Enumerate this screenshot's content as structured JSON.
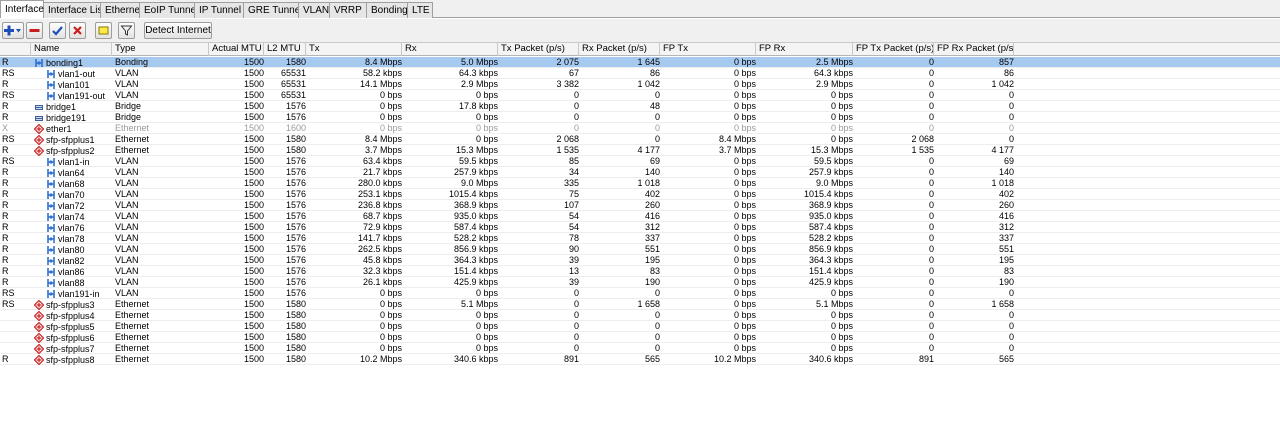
{
  "tabs": [
    "Interface",
    "Interface List",
    "Ethernet",
    "EoIP Tunnel",
    "IP Tunnel",
    "GRE Tunnel",
    "VLAN",
    "VRRP",
    "Bonding",
    "LTE"
  ],
  "active_tab": 0,
  "toolbar": {
    "detect_internet_label": "Detect Internet"
  },
  "columns": [
    "Name",
    "Type",
    "Actual MTU",
    "L2 MTU",
    "Tx",
    "Rx",
    "Tx Packet (p/s)",
    "Rx Packet (p/s)",
    "FP Tx",
    "FP Rx",
    "FP Tx Packet (p/s)",
    "FP Rx Packet (p/s)"
  ],
  "colors": {
    "selected_row": "#a6c9f0",
    "vlan_icon": "#2f6fd0",
    "ethernet_icon": "#c81e1e",
    "bridge_icon": "#3e5f9c"
  },
  "rows": [
    {
      "flags": "R",
      "name": "bonding1",
      "indent": 0,
      "icon": "bonding-icon",
      "type": "Bonding",
      "actual_mtu": "1500",
      "l2_mtu": "1580",
      "tx": "8.4 Mbps",
      "rx": "5.0 Mbps",
      "tx_pps": "2 075",
      "rx_pps": "1 645",
      "fp_tx": "0 bps",
      "fp_rx": "2.5 Mbps",
      "fp_tx_pps": "0",
      "fp_rx_pps": "857",
      "selected": true
    },
    {
      "flags": "RS",
      "name": "vlan1-out",
      "indent": 1,
      "icon": "vlan-icon",
      "type": "VLAN",
      "actual_mtu": "1500",
      "l2_mtu": "65531",
      "tx": "58.2 kbps",
      "rx": "64.3 kbps",
      "tx_pps": "67",
      "rx_pps": "86",
      "fp_tx": "0 bps",
      "fp_rx": "64.3 kbps",
      "fp_tx_pps": "0",
      "fp_rx_pps": "86"
    },
    {
      "flags": "R",
      "name": "vlan101",
      "indent": 1,
      "icon": "vlan-icon",
      "type": "VLAN",
      "actual_mtu": "1500",
      "l2_mtu": "65531",
      "tx": "14.1 Mbps",
      "rx": "2.9 Mbps",
      "tx_pps": "3 382",
      "rx_pps": "1 042",
      "fp_tx": "0 bps",
      "fp_rx": "2.9 Mbps",
      "fp_tx_pps": "0",
      "fp_rx_pps": "1 042"
    },
    {
      "flags": "RS",
      "name": "vlan191-out",
      "indent": 1,
      "icon": "vlan-icon",
      "type": "VLAN",
      "actual_mtu": "1500",
      "l2_mtu": "65531",
      "tx": "0 bps",
      "rx": "0 bps",
      "tx_pps": "0",
      "rx_pps": "0",
      "fp_tx": "0 bps",
      "fp_rx": "0 bps",
      "fp_tx_pps": "0",
      "fp_rx_pps": "0"
    },
    {
      "flags": "R",
      "name": "bridge1",
      "indent": 0,
      "icon": "bridge-icon",
      "type": "Bridge",
      "actual_mtu": "1500",
      "l2_mtu": "1576",
      "tx": "0 bps",
      "rx": "17.8 kbps",
      "tx_pps": "0",
      "rx_pps": "48",
      "fp_tx": "0 bps",
      "fp_rx": "0 bps",
      "fp_tx_pps": "0",
      "fp_rx_pps": "0"
    },
    {
      "flags": "R",
      "name": "bridge191",
      "indent": 0,
      "icon": "bridge-icon",
      "type": "Bridge",
      "actual_mtu": "1500",
      "l2_mtu": "1576",
      "tx": "0 bps",
      "rx": "0 bps",
      "tx_pps": "0",
      "rx_pps": "0",
      "fp_tx": "0 bps",
      "fp_rx": "0 bps",
      "fp_tx_pps": "0",
      "fp_rx_pps": "0"
    },
    {
      "flags": "X",
      "name": "ether1",
      "indent": 0,
      "icon": "ethernet-icon",
      "type": "Ethernet",
      "actual_mtu": "1500",
      "l2_mtu": "1600",
      "tx": "0 bps",
      "rx": "0 bps",
      "tx_pps": "0",
      "rx_pps": "0",
      "fp_tx": "0 bps",
      "fp_rx": "0 bps",
      "fp_tx_pps": "0",
      "fp_rx_pps": "0",
      "disabled": true
    },
    {
      "flags": "RS",
      "name": "sfp-sfpplus1",
      "indent": 0,
      "icon": "ethernet-icon",
      "type": "Ethernet",
      "actual_mtu": "1500",
      "l2_mtu": "1580",
      "tx": "8.4 Mbps",
      "rx": "0 bps",
      "tx_pps": "2 068",
      "rx_pps": "0",
      "fp_tx": "8.4 Mbps",
      "fp_rx": "0 bps",
      "fp_tx_pps": "2 068",
      "fp_rx_pps": "0"
    },
    {
      "flags": "R",
      "name": "sfp-sfpplus2",
      "indent": 0,
      "icon": "ethernet-icon",
      "type": "Ethernet",
      "actual_mtu": "1500",
      "l2_mtu": "1580",
      "tx": "3.7 Mbps",
      "rx": "15.3 Mbps",
      "tx_pps": "1 535",
      "rx_pps": "4 177",
      "fp_tx": "3.7 Mbps",
      "fp_rx": "15.3 Mbps",
      "fp_tx_pps": "1 535",
      "fp_rx_pps": "4 177"
    },
    {
      "flags": "RS",
      "name": "vlan1-in",
      "indent": 1,
      "icon": "vlan-icon",
      "type": "VLAN",
      "actual_mtu": "1500",
      "l2_mtu": "1576",
      "tx": "63.4 kbps",
      "rx": "59.5 kbps",
      "tx_pps": "85",
      "rx_pps": "69",
      "fp_tx": "0 bps",
      "fp_rx": "59.5 kbps",
      "fp_tx_pps": "0",
      "fp_rx_pps": "69"
    },
    {
      "flags": "R",
      "name": "vlan64",
      "indent": 1,
      "icon": "vlan-icon",
      "type": "VLAN",
      "actual_mtu": "1500",
      "l2_mtu": "1576",
      "tx": "21.7 kbps",
      "rx": "257.9 kbps",
      "tx_pps": "34",
      "rx_pps": "140",
      "fp_tx": "0 bps",
      "fp_rx": "257.9 kbps",
      "fp_tx_pps": "0",
      "fp_rx_pps": "140"
    },
    {
      "flags": "R",
      "name": "vlan68",
      "indent": 1,
      "icon": "vlan-icon",
      "type": "VLAN",
      "actual_mtu": "1500",
      "l2_mtu": "1576",
      "tx": "280.0 kbps",
      "rx": "9.0 Mbps",
      "tx_pps": "335",
      "rx_pps": "1 018",
      "fp_tx": "0 bps",
      "fp_rx": "9.0 Mbps",
      "fp_tx_pps": "0",
      "fp_rx_pps": "1 018"
    },
    {
      "flags": "R",
      "name": "vlan70",
      "indent": 1,
      "icon": "vlan-icon",
      "type": "VLAN",
      "actual_mtu": "1500",
      "l2_mtu": "1576",
      "tx": "253.1 kbps",
      "rx": "1015.4 kbps",
      "tx_pps": "75",
      "rx_pps": "402",
      "fp_tx": "0 bps",
      "fp_rx": "1015.4 kbps",
      "fp_tx_pps": "0",
      "fp_rx_pps": "402"
    },
    {
      "flags": "R",
      "name": "vlan72",
      "indent": 1,
      "icon": "vlan-icon",
      "type": "VLAN",
      "actual_mtu": "1500",
      "l2_mtu": "1576",
      "tx": "236.8 kbps",
      "rx": "368.9 kbps",
      "tx_pps": "107",
      "rx_pps": "260",
      "fp_tx": "0 bps",
      "fp_rx": "368.9 kbps",
      "fp_tx_pps": "0",
      "fp_rx_pps": "260"
    },
    {
      "flags": "R",
      "name": "vlan74",
      "indent": 1,
      "icon": "vlan-icon",
      "type": "VLAN",
      "actual_mtu": "1500",
      "l2_mtu": "1576",
      "tx": "68.7 kbps",
      "rx": "935.0 kbps",
      "tx_pps": "54",
      "rx_pps": "416",
      "fp_tx": "0 bps",
      "fp_rx": "935.0 kbps",
      "fp_tx_pps": "0",
      "fp_rx_pps": "416"
    },
    {
      "flags": "R",
      "name": "vlan76",
      "indent": 1,
      "icon": "vlan-icon",
      "type": "VLAN",
      "actual_mtu": "1500",
      "l2_mtu": "1576",
      "tx": "72.9 kbps",
      "rx": "587.4 kbps",
      "tx_pps": "54",
      "rx_pps": "312",
      "fp_tx": "0 bps",
      "fp_rx": "587.4 kbps",
      "fp_tx_pps": "0",
      "fp_rx_pps": "312"
    },
    {
      "flags": "R",
      "name": "vlan78",
      "indent": 1,
      "icon": "vlan-icon",
      "type": "VLAN",
      "actual_mtu": "1500",
      "l2_mtu": "1576",
      "tx": "141.7 kbps",
      "rx": "528.2 kbps",
      "tx_pps": "78",
      "rx_pps": "337",
      "fp_tx": "0 bps",
      "fp_rx": "528.2 kbps",
      "fp_tx_pps": "0",
      "fp_rx_pps": "337"
    },
    {
      "flags": "R",
      "name": "vlan80",
      "indent": 1,
      "icon": "vlan-icon",
      "type": "VLAN",
      "actual_mtu": "1500",
      "l2_mtu": "1576",
      "tx": "262.5 kbps",
      "rx": "856.9 kbps",
      "tx_pps": "90",
      "rx_pps": "551",
      "fp_tx": "0 bps",
      "fp_rx": "856.9 kbps",
      "fp_tx_pps": "0",
      "fp_rx_pps": "551"
    },
    {
      "flags": "R",
      "name": "vlan82",
      "indent": 1,
      "icon": "vlan-icon",
      "type": "VLAN",
      "actual_mtu": "1500",
      "l2_mtu": "1576",
      "tx": "45.8 kbps",
      "rx": "364.3 kbps",
      "tx_pps": "39",
      "rx_pps": "195",
      "fp_tx": "0 bps",
      "fp_rx": "364.3 kbps",
      "fp_tx_pps": "0",
      "fp_rx_pps": "195"
    },
    {
      "flags": "R",
      "name": "vlan86",
      "indent": 1,
      "icon": "vlan-icon",
      "type": "VLAN",
      "actual_mtu": "1500",
      "l2_mtu": "1576",
      "tx": "32.3 kbps",
      "rx": "151.4 kbps",
      "tx_pps": "13",
      "rx_pps": "83",
      "fp_tx": "0 bps",
      "fp_rx": "151.4 kbps",
      "fp_tx_pps": "0",
      "fp_rx_pps": "83"
    },
    {
      "flags": "R",
      "name": "vlan88",
      "indent": 1,
      "icon": "vlan-icon",
      "type": "VLAN",
      "actual_mtu": "1500",
      "l2_mtu": "1576",
      "tx": "26.1 kbps",
      "rx": "425.9 kbps",
      "tx_pps": "39",
      "rx_pps": "190",
      "fp_tx": "0 bps",
      "fp_rx": "425.9 kbps",
      "fp_tx_pps": "0",
      "fp_rx_pps": "190"
    },
    {
      "flags": "RS",
      "name": "vlan191-in",
      "indent": 1,
      "icon": "vlan-icon",
      "type": "VLAN",
      "actual_mtu": "1500",
      "l2_mtu": "1576",
      "tx": "0 bps",
      "rx": "0 bps",
      "tx_pps": "0",
      "rx_pps": "0",
      "fp_tx": "0 bps",
      "fp_rx": "0 bps",
      "fp_tx_pps": "0",
      "fp_rx_pps": "0"
    },
    {
      "flags": "RS",
      "name": "sfp-sfpplus3",
      "indent": 0,
      "icon": "ethernet-icon",
      "type": "Ethernet",
      "actual_mtu": "1500",
      "l2_mtu": "1580",
      "tx": "0 bps",
      "rx": "5.1 Mbps",
      "tx_pps": "0",
      "rx_pps": "1 658",
      "fp_tx": "0 bps",
      "fp_rx": "5.1 Mbps",
      "fp_tx_pps": "0",
      "fp_rx_pps": "1 658"
    },
    {
      "flags": "",
      "name": "sfp-sfpplus4",
      "indent": 0,
      "icon": "ethernet-icon",
      "type": "Ethernet",
      "actual_mtu": "1500",
      "l2_mtu": "1580",
      "tx": "0 bps",
      "rx": "0 bps",
      "tx_pps": "0",
      "rx_pps": "0",
      "fp_tx": "0 bps",
      "fp_rx": "0 bps",
      "fp_tx_pps": "0",
      "fp_rx_pps": "0"
    },
    {
      "flags": "",
      "name": "sfp-sfpplus5",
      "indent": 0,
      "icon": "ethernet-icon",
      "type": "Ethernet",
      "actual_mtu": "1500",
      "l2_mtu": "1580",
      "tx": "0 bps",
      "rx": "0 bps",
      "tx_pps": "0",
      "rx_pps": "0",
      "fp_tx": "0 bps",
      "fp_rx": "0 bps",
      "fp_tx_pps": "0",
      "fp_rx_pps": "0"
    },
    {
      "flags": "",
      "name": "sfp-sfpplus6",
      "indent": 0,
      "icon": "ethernet-icon",
      "type": "Ethernet",
      "actual_mtu": "1500",
      "l2_mtu": "1580",
      "tx": "0 bps",
      "rx": "0 bps",
      "tx_pps": "0",
      "rx_pps": "0",
      "fp_tx": "0 bps",
      "fp_rx": "0 bps",
      "fp_tx_pps": "0",
      "fp_rx_pps": "0"
    },
    {
      "flags": "",
      "name": "sfp-sfpplus7",
      "indent": 0,
      "icon": "ethernet-icon",
      "type": "Ethernet",
      "actual_mtu": "1500",
      "l2_mtu": "1580",
      "tx": "0 bps",
      "rx": "0 bps",
      "tx_pps": "0",
      "rx_pps": "0",
      "fp_tx": "0 bps",
      "fp_rx": "0 bps",
      "fp_tx_pps": "0",
      "fp_rx_pps": "0"
    },
    {
      "flags": "R",
      "name": "sfp-sfpplus8",
      "indent": 0,
      "icon": "ethernet-icon",
      "type": "Ethernet",
      "actual_mtu": "1500",
      "l2_mtu": "1580",
      "tx": "10.2 Mbps",
      "rx": "340.6 kbps",
      "tx_pps": "891",
      "rx_pps": "565",
      "fp_tx": "10.2 Mbps",
      "fp_rx": "340.6 kbps",
      "fp_tx_pps": "891",
      "fp_rx_pps": "565"
    }
  ]
}
